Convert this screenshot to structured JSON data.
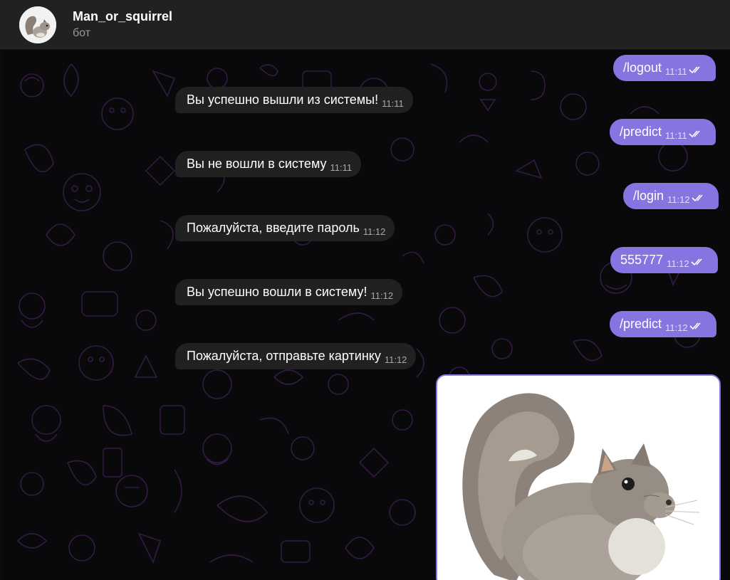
{
  "header": {
    "chat_name": "Man_or_squirrel",
    "chat_status": "бот",
    "avatar_icon": "squirrel-avatar-icon"
  },
  "messages": [
    {
      "direction": "out",
      "text": "/logout",
      "time": "11:11"
    },
    {
      "direction": "in",
      "text": "Вы успешно вышли из системы!",
      "time": "11:11"
    },
    {
      "direction": "out",
      "text": "/predict",
      "time": "11:11"
    },
    {
      "direction": "in",
      "text": "Вы не вошли в систему",
      "time": "11:11"
    },
    {
      "direction": "out",
      "text": "/login",
      "time": "11:12"
    },
    {
      "direction": "in",
      "text": "Пожалуйста, введите пароль",
      "time": "11:12"
    },
    {
      "direction": "out",
      "text": "555777",
      "time": "11:12"
    },
    {
      "direction": "in",
      "text": "Вы успешно вошли в систему!",
      "time": "11:12"
    },
    {
      "direction": "out",
      "text": "/predict",
      "time": "11:12"
    },
    {
      "direction": "in",
      "text": "Пожалуйста, отправьте картинку",
      "time": "11:12"
    }
  ],
  "photo": {
    "subject": "squirrel-photo"
  },
  "colors": {
    "outgoing_bubble": "#8774e1",
    "incoming_bubble": "#212121",
    "header_bg": "#212121",
    "chat_bg": "#09080b"
  }
}
